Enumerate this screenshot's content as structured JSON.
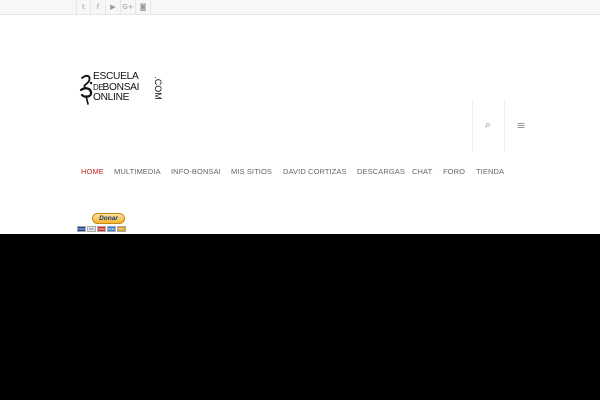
{
  "topbar": {
    "social": [
      {
        "icon": "twitter-icon",
        "glyph": "𝕥"
      },
      {
        "icon": "facebook-icon",
        "glyph": "f"
      },
      {
        "icon": "youtube-icon",
        "glyph": "▶"
      },
      {
        "icon": "google-plus-icon",
        "glyph": "G+"
      },
      {
        "icon": "instagram-icon",
        "glyph": "◙"
      }
    ]
  },
  "logo": {
    "line1": "ESCUELA",
    "line2_small": "DE",
    "line2": "BONSAI",
    "line3": "ONLINE",
    "suffix": ".COM"
  },
  "header": {
    "search_glyph": "⌕",
    "menu_glyph": "≡"
  },
  "nav": {
    "items": [
      {
        "label": "HOME",
        "active": true
      },
      {
        "label": "MULTIMEDIA"
      },
      {
        "label": "INFO-BONSAI"
      },
      {
        "label": "MIS SITIOS"
      },
      {
        "label": "DAVID CORTIZAS"
      },
      {
        "label": "DESCARGAS"
      },
      {
        "label": "CHAT"
      },
      {
        "label": "FORO"
      },
      {
        "label": "TIENDA"
      }
    ]
  },
  "donate": {
    "label": "Donar",
    "cards": [
      "VISA",
      "MC",
      "VISA",
      "AMEX",
      "MC"
    ]
  },
  "colors": {
    "accent": "#c62828",
    "nav_text": "#666666",
    "media_bg": "#000000"
  }
}
